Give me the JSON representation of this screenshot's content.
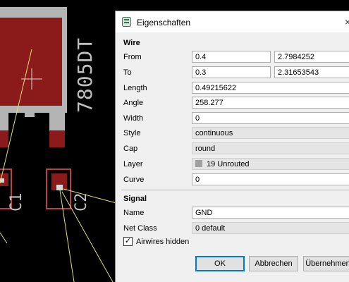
{
  "pcb": {
    "part_name": "7805DT",
    "label_c1": "C1",
    "label_c2": "C2"
  },
  "dialog": {
    "title": "Eigenschaften",
    "close_glyph": "×",
    "wire_section": "Wire",
    "from_label": "From",
    "from_x": "0.4",
    "from_y": "2.7984252",
    "to_label": "To",
    "to_x": "0.3",
    "to_y": "2.31653543",
    "length_label": "Length",
    "length_value": "0.49215622",
    "angle_label": "Angle",
    "angle_value": "258.277",
    "width_label": "Width",
    "width_value": "0",
    "style_label": "Style",
    "style_value": "continuous",
    "cap_label": "Cap",
    "cap_value": "round",
    "layer_label": "Layer",
    "layer_value": "19 Unrouted",
    "curve_label": "Curve",
    "curve_value": "0",
    "signal_section": "Signal",
    "name_label": "Name",
    "name_value": "GND",
    "netclass_label": "Net Class",
    "netclass_value": "0 default",
    "airwires_label": "Airwires hidden",
    "airwires_checked": "✓",
    "ok_label": "OK",
    "cancel_label": "Abbrechen",
    "apply_label": "Übernehmen"
  },
  "colors": {
    "pad_red": "#8b1a1a",
    "silk_gray": "#b4b4b4",
    "airwire_yellow": "#e8e070",
    "dialog_bg": "#f0f0f0"
  }
}
